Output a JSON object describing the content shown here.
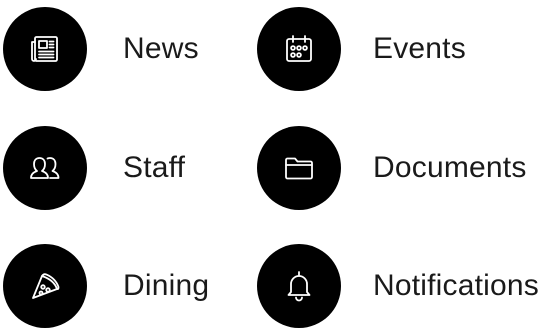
{
  "menu": {
    "items": [
      {
        "label": "News",
        "icon": "newspaper-icon"
      },
      {
        "label": "Events",
        "icon": "calendar-icon"
      },
      {
        "label": "Staff",
        "icon": "people-icon"
      },
      {
        "label": "Documents",
        "icon": "folder-icon"
      },
      {
        "label": "Dining",
        "icon": "pizza-slice-icon"
      },
      {
        "label": "Notifications",
        "icon": "bell-icon"
      }
    ],
    "colors": {
      "icon_background": "#000000",
      "icon_stroke": "#ffffff",
      "label_text": "#1a1a1a"
    }
  }
}
